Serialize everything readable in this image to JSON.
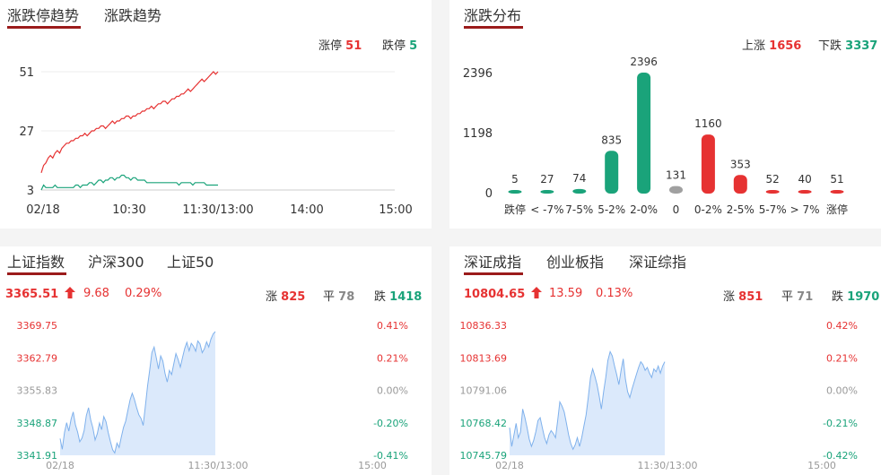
{
  "limit_panel": {
    "tabs": [
      "涨跌停趋势",
      "涨跌趋势"
    ],
    "stats": {
      "up_label": "涨停",
      "up_value": "51",
      "down_label": "跌停",
      "down_value": "5"
    },
    "chart_data": {
      "type": "line",
      "x_ticks": [
        "02/18",
        "10:30",
        "11:30/13:00",
        "14:00",
        "15:00"
      ],
      "y_ticks": [
        "51",
        "27",
        "3"
      ],
      "ylim": [
        3,
        51
      ],
      "series": [
        {
          "color": "#e63232",
          "values": [
            10,
            13,
            14,
            16,
            17,
            16,
            18,
            19,
            18,
            20,
            21,
            22,
            22,
            23,
            23,
            24,
            24,
            25,
            25,
            26,
            25,
            26,
            27,
            27,
            28,
            28,
            29,
            29,
            28,
            29,
            30,
            31,
            30,
            31,
            31,
            32,
            32,
            33,
            33,
            32,
            33,
            33,
            34,
            34,
            35,
            35,
            36,
            36,
            37,
            36,
            37,
            38,
            38,
            39,
            39,
            38,
            39,
            40,
            40,
            41,
            41,
            42,
            42,
            43,
            44,
            43,
            44,
            45,
            46,
            47,
            48,
            47,
            48,
            49,
            50,
            51,
            50,
            51
          ]
        },
        {
          "color": "#1aa37a",
          "values": [
            3,
            5,
            4,
            4,
            4,
            4,
            5,
            4,
            4,
            4,
            4,
            4,
            4,
            4,
            4,
            5,
            5,
            4,
            5,
            5,
            5,
            6,
            6,
            5,
            6,
            7,
            7,
            6,
            7,
            7,
            8,
            8,
            7,
            8,
            8,
            9,
            9,
            8,
            8,
            7,
            8,
            8,
            7,
            7,
            7,
            7,
            6,
            6,
            6,
            6,
            6,
            6,
            6,
            6,
            6,
            6,
            6,
            6,
            6,
            6,
            5,
            6,
            6,
            6,
            6,
            6,
            5,
            6,
            6,
            6,
            6,
            6,
            5,
            5,
            5,
            5,
            5,
            5
          ]
        }
      ]
    }
  },
  "dist_panel": {
    "tabs": [
      "涨跌分布"
    ],
    "stats": {
      "up_label": "上涨",
      "up_value": "1656",
      "down_label": "下跌",
      "down_value": "3337"
    },
    "chart_data": {
      "type": "bar",
      "y_ticks": [
        "2396",
        "1198",
        "0"
      ],
      "ylim": [
        0,
        2396
      ],
      "categories": [
        "跌停",
        "< -7%",
        "7-5%",
        "5-2%",
        "2-0%",
        "0",
        "0-2%",
        "2-5%",
        "5-7%",
        "> 7%",
        "涨停"
      ],
      "values": [
        5,
        27,
        74,
        835,
        2396,
        131,
        1160,
        353,
        52,
        40,
        51
      ],
      "colors": [
        "#1aa37a",
        "#1aa37a",
        "#1aa37a",
        "#1aa37a",
        "#1aa37a",
        "#a0a0a0",
        "#e63232",
        "#e63232",
        "#e63232",
        "#e63232",
        "#e63232"
      ]
    }
  },
  "sh_panel": {
    "tabs": [
      "上证指数",
      "沪深300",
      "上证50"
    ],
    "price": "3365.51",
    "change": "9.68",
    "pct": "0.29%",
    "breadth": {
      "up_label": "涨",
      "up_value": "825",
      "flat_label": "平",
      "flat_value": "78",
      "down_label": "跌",
      "down_value": "1418"
    },
    "chart_data": {
      "type": "area",
      "y_ticks_left": [
        "3369.75",
        "3362.79",
        "3355.83",
        "3348.87",
        "3341.91"
      ],
      "y_ticks_right": [
        "0.41%",
        "0.21%",
        "0.00%",
        "-0.20%",
        "-0.41%"
      ],
      "x_ticks": [
        "02/18",
        "11:30/13:00",
        "15:00"
      ],
      "ylim": [
        3341.91,
        3369.75
      ],
      "values": [
        3345.5,
        3343.2,
        3346.8,
        3348.9,
        3347.1,
        3349.6,
        3351.2,
        3348.4,
        3346.9,
        3344.8,
        3345.6,
        3347.2,
        3350.4,
        3352.1,
        3349.5,
        3347.8,
        3345.2,
        3346.5,
        3348.8,
        3347.4,
        3350.2,
        3349.1,
        3346.8,
        3344.9,
        3343.1,
        3342.4,
        3344.5,
        3343.6,
        3345.8,
        3347.9,
        3349.2,
        3351.5,
        3353.8,
        3355.2,
        3353.9,
        3352.1,
        3350.6,
        3349.8,
        3348.3,
        3352.4,
        3356.8,
        3360.2,
        3363.9,
        3365.1,
        3362.8,
        3360.4,
        3363.2,
        3362.1,
        3359.4,
        3357.6,
        3360.1,
        3359.2,
        3361.5,
        3363.7,
        3362.4,
        3360.8,
        3362.9,
        3364.8,
        3366.1,
        3364.3,
        3365.9,
        3365.3,
        3364.2,
        3366.4,
        3365.8,
        3363.9,
        3364.7,
        3366.2,
        3365.1,
        3366.8,
        3367.9,
        3368.4
      ]
    }
  },
  "sz_panel": {
    "tabs": [
      "深证成指",
      "创业板指",
      "深证综指"
    ],
    "price": "10804.65",
    "change": "13.59",
    "pct": "0.13%",
    "breadth": {
      "up_label": "涨",
      "up_value": "851",
      "flat_label": "平",
      "flat_value": "71",
      "down_label": "跌",
      "down_value": "1970"
    },
    "chart_data": {
      "type": "area",
      "y_ticks_left": [
        "10836.33",
        "10813.69",
        "10791.06",
        "10768.42",
        "10745.79"
      ],
      "y_ticks_right": [
        "0.42%",
        "0.21%",
        "0.00%",
        "-0.21%",
        "-0.42%"
      ],
      "x_ticks": [
        "02/18",
        "11:30/13:00",
        "15:00"
      ],
      "ylim": [
        10745.79,
        10836.33
      ],
      "values": [
        10765,
        10752,
        10760,
        10768,
        10758,
        10762,
        10778,
        10772,
        10765,
        10757,
        10752,
        10756,
        10762,
        10770,
        10772,
        10765,
        10758,
        10754,
        10760,
        10763,
        10761,
        10758,
        10770,
        10783,
        10780,
        10776,
        10768,
        10760,
        10754,
        10750,
        10753,
        10758,
        10752,
        10758,
        10766,
        10774,
        10786,
        10800,
        10806,
        10801,
        10795,
        10787,
        10778,
        10790,
        10800,
        10812,
        10818,
        10815,
        10808,
        10802,
        10795,
        10805,
        10813,
        10799,
        10790,
        10786,
        10792,
        10797,
        10802,
        10807,
        10811,
        10809,
        10805,
        10807,
        10803,
        10800,
        10806,
        10804,
        10808,
        10803,
        10808,
        10811
      ]
    }
  }
}
